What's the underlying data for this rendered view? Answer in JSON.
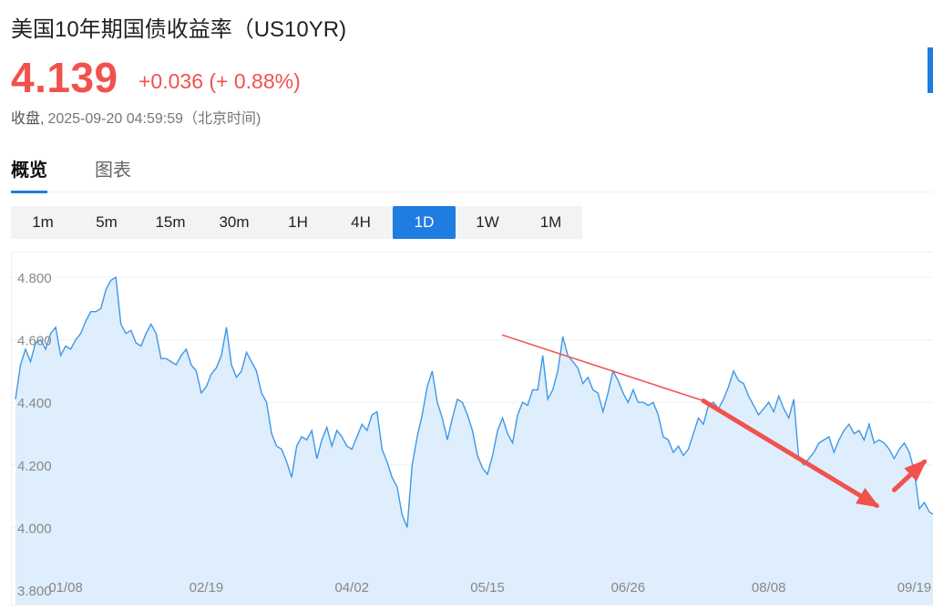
{
  "header": {
    "title": "美国10年期国债收益率（US10YR)",
    "price": "4.139",
    "change": "+0.036 (+ 0.88%)",
    "close_label": "收盘,",
    "close_timestamp": "2025-09-20 04:59:59（北京时间)"
  },
  "tabs": [
    {
      "label": "概览",
      "active": true
    },
    {
      "label": "图表",
      "active": false
    }
  ],
  "timeframes": [
    {
      "label": "1m",
      "active": false
    },
    {
      "label": "5m",
      "active": false
    },
    {
      "label": "15m",
      "active": false
    },
    {
      "label": "30m",
      "active": false
    },
    {
      "label": "1H",
      "active": false
    },
    {
      "label": "4H",
      "active": false
    },
    {
      "label": "1D",
      "active": true
    },
    {
      "label": "1W",
      "active": false
    },
    {
      "label": "1M",
      "active": false
    }
  ],
  "colors": {
    "up_red": "#f1524d",
    "accent_blue": "#1f7ce0",
    "line_blue": "#3f97e6",
    "area_fill": "#deeefc",
    "annotation_red": "#f1524d"
  },
  "chart_data": {
    "type": "area",
    "ylim": [
      3.8,
      4.8
    ],
    "xlim": [
      0,
      180
    ],
    "y_ticks": [
      {
        "value": 4.8,
        "label": "4.800"
      },
      {
        "value": 4.6,
        "label": "4.600"
      },
      {
        "value": 4.4,
        "label": "4.400"
      },
      {
        "value": 4.2,
        "label": "4.200"
      },
      {
        "value": 4.0,
        "label": "4.000"
      },
      {
        "value": 3.8,
        "label": "3.800"
      }
    ],
    "x_ticks": [
      {
        "index": 10,
        "label": "01/08"
      },
      {
        "index": 38,
        "label": "02/19"
      },
      {
        "index": 67,
        "label": "04/02"
      },
      {
        "index": 94,
        "label": "05/15"
      },
      {
        "index": 122,
        "label": "06/26"
      },
      {
        "index": 150,
        "label": "08/08"
      },
      {
        "index": 179,
        "label": "09/19"
      }
    ],
    "series": [
      {
        "values": [
          4.41,
          4.52,
          4.57,
          4.53,
          4.59,
          4.6,
          4.57,
          4.62,
          4.64,
          4.55,
          4.58,
          4.57,
          4.6,
          4.62,
          4.66,
          4.69,
          4.69,
          4.7,
          4.76,
          4.79,
          4.8,
          4.65,
          4.62,
          4.63,
          4.59,
          4.58,
          4.62,
          4.65,
          4.62,
          4.54,
          4.54,
          4.53,
          4.52,
          4.55,
          4.57,
          4.52,
          4.5,
          4.43,
          4.45,
          4.49,
          4.51,
          4.55,
          4.64,
          4.52,
          4.48,
          4.5,
          4.56,
          4.53,
          4.5,
          4.43,
          4.4,
          4.3,
          4.26,
          4.25,
          4.21,
          4.16,
          4.26,
          4.29,
          4.28,
          4.31,
          4.22,
          4.28,
          4.32,
          4.26,
          4.31,
          4.29,
          4.26,
          4.25,
          4.29,
          4.33,
          4.31,
          4.36,
          4.37,
          4.25,
          4.21,
          4.16,
          4.13,
          4.04,
          4.0,
          4.2,
          4.29,
          4.36,
          4.45,
          4.5,
          4.4,
          4.35,
          4.28,
          4.35,
          4.41,
          4.4,
          4.36,
          4.31,
          4.23,
          4.19,
          4.17,
          4.23,
          4.31,
          4.35,
          4.3,
          4.27,
          4.36,
          4.4,
          4.39,
          4.44,
          4.44,
          4.55,
          4.41,
          4.44,
          4.5,
          4.61,
          4.55,
          4.53,
          4.51,
          4.46,
          4.48,
          4.44,
          4.43,
          4.37,
          4.43,
          4.5,
          4.47,
          4.43,
          4.4,
          4.44,
          4.4,
          4.4,
          4.39,
          4.4,
          4.36,
          4.29,
          4.28,
          4.24,
          4.26,
          4.23,
          4.25,
          4.3,
          4.35,
          4.33,
          4.39,
          4.4,
          4.38,
          4.41,
          4.45,
          4.5,
          4.47,
          4.46,
          4.42,
          4.39,
          4.36,
          4.38,
          4.4,
          4.37,
          4.42,
          4.38,
          4.35,
          4.41,
          4.22,
          4.2,
          4.22,
          4.24,
          4.27,
          4.28,
          4.29,
          4.24,
          4.28,
          4.31,
          4.33,
          4.3,
          4.31,
          4.28,
          4.33,
          4.27,
          4.28,
          4.27,
          4.25,
          4.22,
          4.25,
          4.27,
          4.24,
          4.18,
          4.06,
          4.08,
          4.05,
          4.04,
          4.06,
          4.04,
          4.03,
          4.1,
          4.13,
          4.14
        ]
      }
    ],
    "annotations": [
      {
        "kind": "thin-line",
        "from": {
          "x": 97.0,
          "y": 4.615
        },
        "to": {
          "x": 137.0,
          "y": 4.405
        }
      },
      {
        "kind": "thick-arrow",
        "from": {
          "x": 137.0,
          "y": 4.405
        },
        "to": {
          "x": 171.5,
          "y": 4.07
        }
      },
      {
        "kind": "thick-arrow",
        "from": {
          "x": 175.0,
          "y": 4.12
        },
        "to": {
          "x": 181.0,
          "y": 4.21
        }
      }
    ]
  }
}
